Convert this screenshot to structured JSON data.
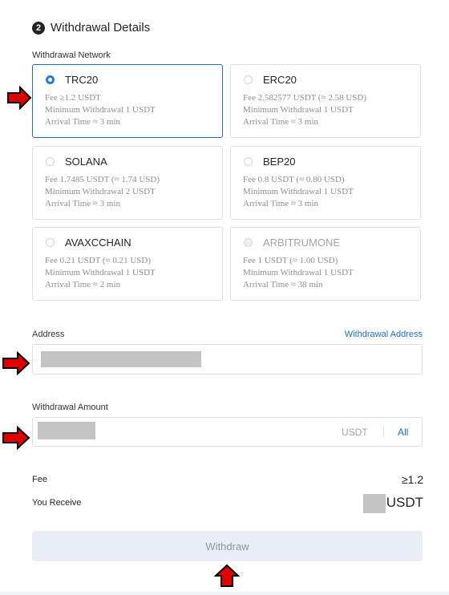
{
  "section": {
    "step": "2",
    "title": "Withdrawal Details"
  },
  "network": {
    "label": "Withdrawal Network",
    "cards": [
      {
        "name": "TRC20",
        "fee": "Fee ≥1.2 USDT",
        "min": "Minimum Withdrawal 1 USDT",
        "arrival": "Arrival Time ≈ 3 min",
        "selected": true
      },
      {
        "name": "ERC20",
        "fee": "Fee 2.582577 USDT (≈ 2.58 USD)",
        "min": "Minimum Withdrawal 1 USDT",
        "arrival": "Arrival Time ≈ 3 min"
      },
      {
        "name": "SOLANA",
        "fee": "Fee 1.7485 USDT (≈ 1.74 USD)",
        "min": "Minimum Withdrawal 2 USDT",
        "arrival": "Arrival Time ≈ 3 min"
      },
      {
        "name": "BEP20",
        "fee": "Fee 0.8 USDT (≈ 0.80 USD)",
        "min": "Minimum Withdrawal 1 USDT",
        "arrival": "Arrival Time ≈ 3 min"
      },
      {
        "name": "AVAXCCHAIN",
        "fee": "Fee 0.21 USDT (≈ 0.21 USD)",
        "min": "Minimum Withdrawal 1 USDT",
        "arrival": "Arrival Time ≈ 2 min"
      },
      {
        "name": "ARBITRUMONE",
        "fee": "Fee 1 USDT (≈ 1.00 USD)",
        "min": "Minimum Withdrawal 1 USDT",
        "arrival": "Arrival Time ≈ 38 min",
        "disabled": true
      }
    ]
  },
  "address": {
    "label": "Address",
    "link": "Withdrawal Address"
  },
  "amount": {
    "label": "Withdrawal Amount",
    "unit": "USDT",
    "all": "All"
  },
  "summary": {
    "fee_label": "Fee",
    "fee_value": "≥1.2",
    "receive_label": "You Receive",
    "receive_unit": "USDT"
  },
  "withdraw_button": "Withdraw",
  "colors": {
    "accent": "#1c6fbf",
    "arrow": "#e00000"
  }
}
